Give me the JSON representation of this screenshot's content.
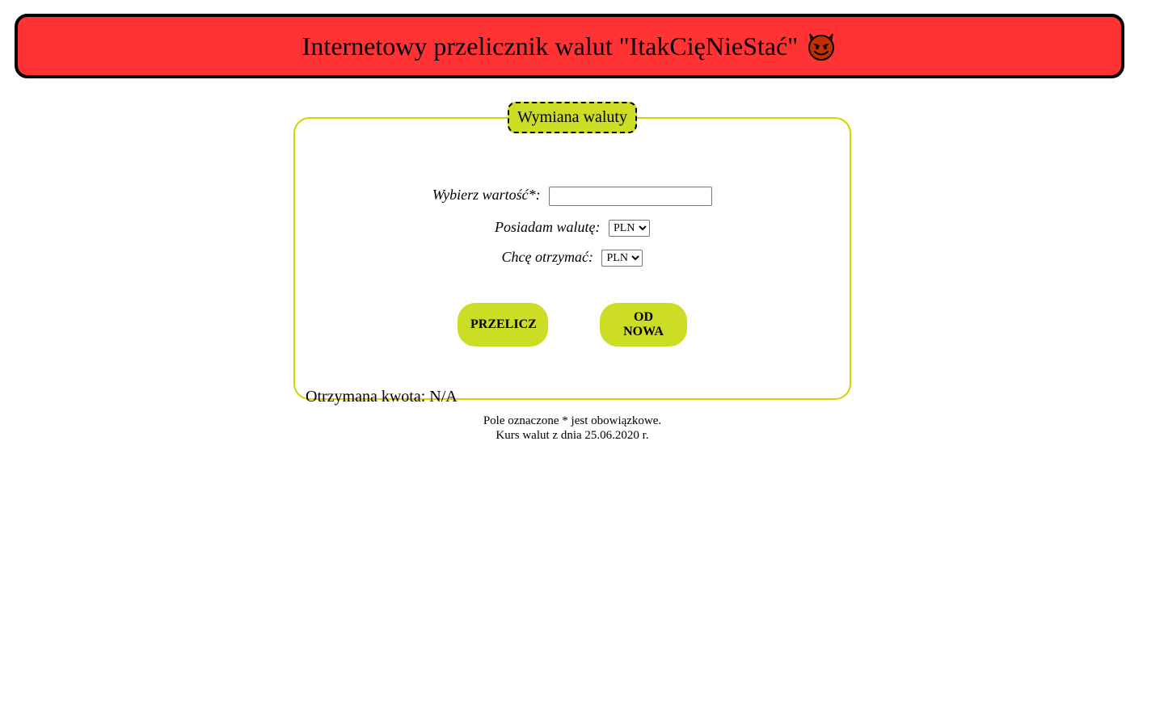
{
  "header": {
    "title": "Internetowy przelicznik walut \"ItakCięNieStać\"",
    "icon": "smiling-devil-icon",
    "background_color": "#ff3333"
  },
  "form": {
    "legend": "Wymiana waluty",
    "accent_color": "#cddc24",
    "border_color": "#d4d400",
    "amount_label": "Wybierz wartość*:",
    "amount_value": "",
    "from_label": "Posiadam walutę:",
    "from_selected": "PLN",
    "to_label": "Chcę otrzymać:",
    "to_selected": "PLN",
    "calc_button": "PRZELICZ",
    "reset_button": "OD NOWA",
    "result_label": "Otrzymana kwota: N/A"
  },
  "footer": {
    "line1": "Pole oznaczone * jest obowiązkowe.",
    "line2": "Kurs walut z dnia 25.06.2020 r."
  }
}
